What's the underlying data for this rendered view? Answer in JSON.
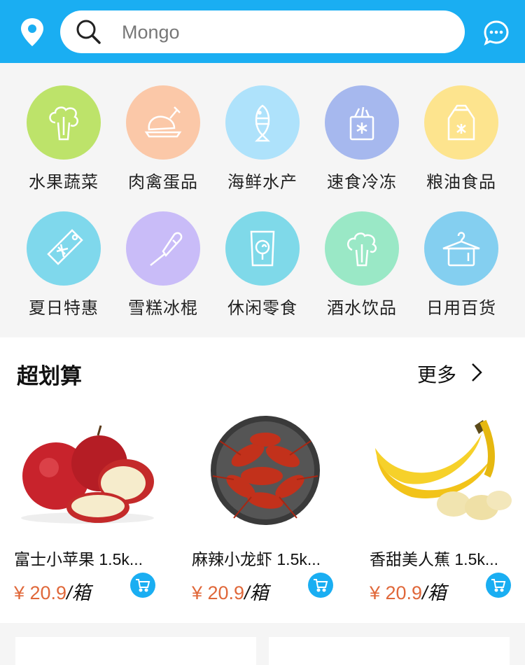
{
  "search": {
    "placeholder": "Mongo"
  },
  "colors": {
    "header": "#1aaef2",
    "price": "#e0683a"
  },
  "categories": [
    {
      "label": "水果蔬菜",
      "icon": "vegetable-icon",
      "color": "#bde36a"
    },
    {
      "label": "肉禽蛋品",
      "icon": "chicken-icon",
      "color": "#fbc8a8"
    },
    {
      "label": "海鲜水产",
      "icon": "fish-icon",
      "color": "#aee2fb"
    },
    {
      "label": "速食冷冻",
      "icon": "frozen-food-icon",
      "color": "#a6b8ee"
    },
    {
      "label": "粮油食品",
      "icon": "rice-bag-icon",
      "color": "#fde48e"
    },
    {
      "label": "夏日特惠",
      "icon": "price-tag-icon",
      "color": "#7fd8ec"
    },
    {
      "label": "雪糕冰棍",
      "icon": "popsicle-icon",
      "color": "#c9bcf8"
    },
    {
      "label": "休闲零食",
      "icon": "candy-bag-icon",
      "color": "#7fd9e9"
    },
    {
      "label": "酒水饮品",
      "icon": "cabbage-icon",
      "color": "#9ae8c6"
    },
    {
      "label": "日用百货",
      "icon": "hanger-icon",
      "color": "#84cff0"
    }
  ],
  "deals": {
    "title": "超划算",
    "more_label": "更多",
    "products": [
      {
        "name": "富士小苹果 1.5k...",
        "price": "¥ 20.9",
        "unit": "/箱",
        "image": "apple-image"
      },
      {
        "name": "麻辣小龙虾 1.5k...",
        "price": "¥ 20.9",
        "unit": "/箱",
        "image": "crayfish-image"
      },
      {
        "name": "香甜美人蕉 1.5k...",
        "price": "¥ 20.9",
        "unit": "/箱",
        "image": "banana-image"
      }
    ]
  }
}
